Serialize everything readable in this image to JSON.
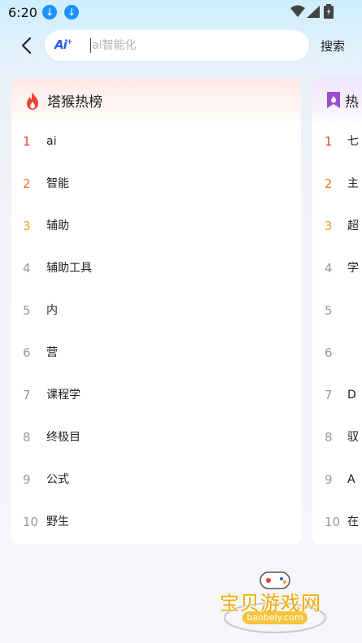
{
  "status_bar": {
    "time": "6:20",
    "download_icons": [
      "download-icon",
      "download-icon"
    ],
    "icons": [
      "wifi-icon",
      "signal-icon",
      "battery-icon"
    ]
  },
  "search": {
    "placeholder": "ai智能化",
    "value": "",
    "button_label": "搜索",
    "ai_icon_text": "Ai"
  },
  "colors": {
    "rank_1": "#e5412f",
    "rank_2": "#f07423",
    "rank_3": "#f2a51c",
    "rank_other": "#999999",
    "accent": "#2f5cf6"
  },
  "card1": {
    "title": "塔猴热榜",
    "icon": "fire-icon",
    "items": [
      {
        "rank": "1",
        "text": "ai"
      },
      {
        "rank": "2",
        "text": "智能"
      },
      {
        "rank": "3",
        "text": "辅助"
      },
      {
        "rank": "4",
        "text": "辅助工具"
      },
      {
        "rank": "5",
        "text": "内"
      },
      {
        "rank": "6",
        "text": "营"
      },
      {
        "rank": "7",
        "text": "课程学"
      },
      {
        "rank": "8",
        "text": "终极目"
      },
      {
        "rank": "9",
        "text": "公式"
      },
      {
        "rank": "10",
        "text": "野生"
      }
    ]
  },
  "card2": {
    "title": "热",
    "icon": "bookmark-icon",
    "items": [
      {
        "rank": "1",
        "text": "七"
      },
      {
        "rank": "2",
        "text": "主"
      },
      {
        "rank": "3",
        "text": "超"
      },
      {
        "rank": "4",
        "text": "学"
      },
      {
        "rank": "5",
        "text": ""
      },
      {
        "rank": "6",
        "text": ""
      },
      {
        "rank": "7",
        "text": "D"
      },
      {
        "rank": "8",
        "text": "驭"
      },
      {
        "rank": "9",
        "text": "A"
      },
      {
        "rank": "10",
        "text": "在"
      }
    ]
  },
  "watermark": {
    "text": "宝贝游戏网",
    "url": "baobeiy.com"
  }
}
